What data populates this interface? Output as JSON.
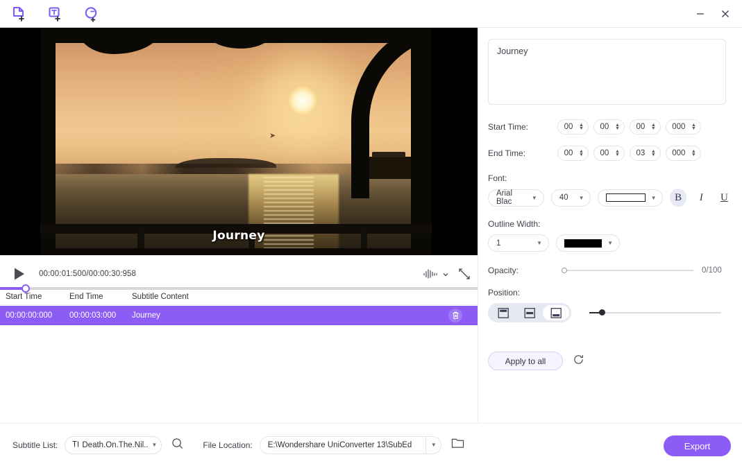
{
  "titlebar": {
    "icons": [
      {
        "name": "add-media-file-icon",
        "title": "Add media file"
      },
      {
        "name": "add-subtitle-file-icon",
        "title": "Add subtitle file"
      },
      {
        "name": "auto-generate-subtitle-icon",
        "title": "Auto generate subtitle"
      }
    ],
    "minimize_label": "—",
    "close_label": "✕"
  },
  "preview": {
    "subtitle_overlay_text": "Journey",
    "time_display": "00:00:01:500/00:00:30:958",
    "play_label": "▶"
  },
  "table": {
    "headers": [
      "Start Time",
      "End Time",
      "Subtitle Content"
    ],
    "rows": [
      {
        "start": "00:00:00:000",
        "end": "00:00:03:000",
        "content": "Journey"
      }
    ]
  },
  "editor": {
    "text_value": "Journey",
    "start_time_label": "Start Time:",
    "end_time_label": "End Time:",
    "start_time": {
      "hh": "00",
      "mm": "00",
      "ss": "00",
      "ms": "000"
    },
    "end_time": {
      "hh": "00",
      "mm": "00",
      "ss": "03",
      "ms": "000"
    },
    "font_label": "Font:",
    "font_family": "Arial Blac",
    "font_size": "40",
    "font_color": "#FFFFFF",
    "bold_label": "B",
    "italic_label": "I",
    "underline_label": "U",
    "bold_active": true,
    "outline_width_label": "Outline Width:",
    "outline_width": "1",
    "outline_color": "#000000",
    "opacity_label": "Opacity:",
    "opacity_value": "0/100",
    "position_label": "Position:",
    "position_options": [
      "position-top",
      "position-middle",
      "position-bottom"
    ],
    "position_selected": 2,
    "apply_to_all_label": "Apply to all",
    "reset_title": "Reset"
  },
  "bottom": {
    "subtitle_list_label": "Subtitle List:",
    "subtitle_list_prefix": "T|",
    "subtitle_list_value": "Death.On.The.Nil...",
    "file_location_label": "File Location:",
    "file_location_value": "E:\\Wondershare UniConverter 13\\SubEd",
    "export_label": "Export"
  },
  "colors": {
    "accent": "#8B5CF6",
    "row_highlight": "#8B5CF6",
    "panel_border": "#ECECF0"
  }
}
